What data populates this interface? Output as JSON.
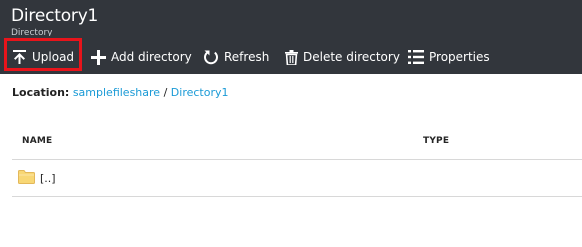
{
  "header": {
    "title": "Directory1",
    "subtitle": "Directory"
  },
  "toolbar": {
    "upload_label": "Upload",
    "add_directory_label": "Add directory",
    "refresh_label": "Refresh",
    "delete_directory_label": "Delete directory",
    "properties_label": "Properties"
  },
  "location": {
    "label": "Location:",
    "share": "samplefileshare",
    "separator": "/",
    "directory": "Directory1"
  },
  "table": {
    "columns": [
      "NAME",
      "TYPE"
    ],
    "rows": [
      {
        "name": "[..]",
        "type": "",
        "icon": "folder-icon"
      }
    ]
  },
  "colors": {
    "header_bg": "#32363c",
    "highlight": "#e8141b",
    "link": "#1a9ad6",
    "folder": "#f8d775"
  }
}
